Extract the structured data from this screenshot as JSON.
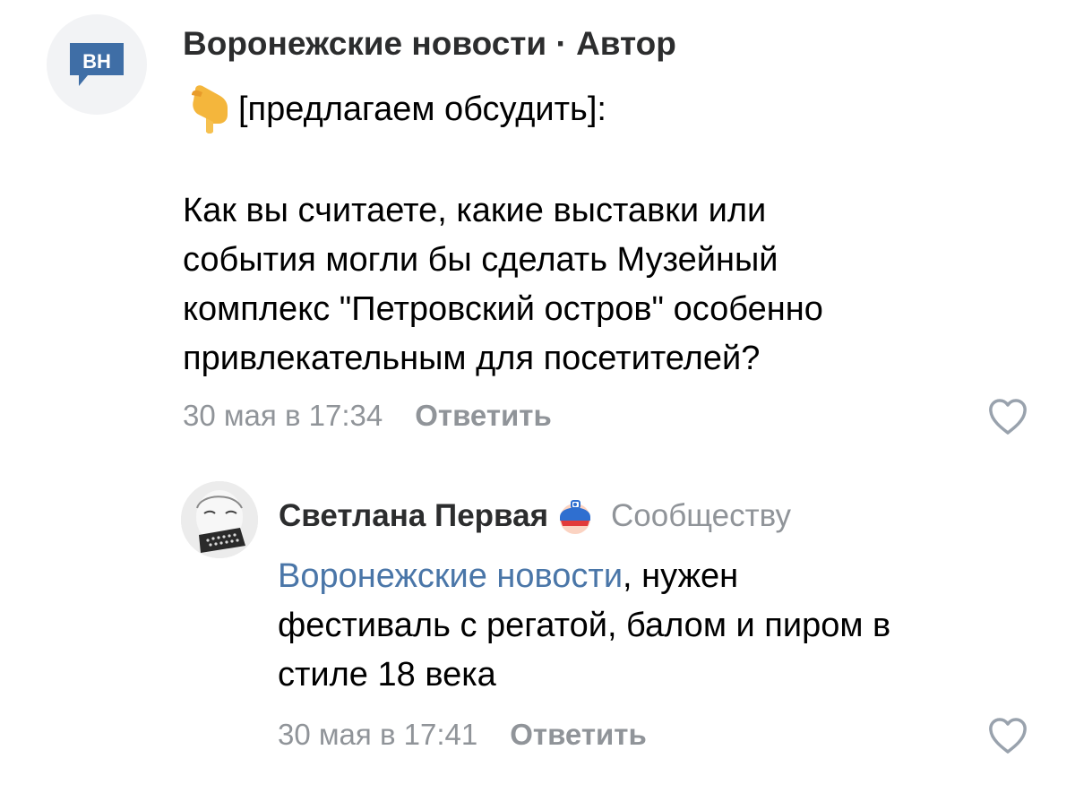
{
  "comment": {
    "avatar_initials": "ВН",
    "author": "Воронежские новости",
    "author_separator": " · ",
    "author_role": "Автор",
    "emoji_icon": "backhand-index-pointing-down-icon",
    "line1": "[предлагаем обсудить]:",
    "body_lines": [
      "Как вы считаете, какие выставки или",
      "события могли бы сделать Музейный",
      "комплекс \"Петровский остров\" особенно",
      "привлекательным для посетителей?"
    ],
    "time": "30 мая в 17:34",
    "reply_label": "Ответить"
  },
  "reply": {
    "author": "Светлана Первая",
    "badge_icon": "donut-badge-icon",
    "to_whom": "Сообществу",
    "mention": "Воронежские новости",
    "text_after_mention": ", нужен",
    "lines": [
      "фестиваль с регатой, балом и пиром в",
      "стиле 18 века"
    ],
    "time": "30 мая в 17:41",
    "reply_label": "Ответить"
  },
  "colors": {
    "accent_link": "#4a76a8",
    "secondary_text": "#909499",
    "brand_badge": "#3f6ea6"
  }
}
